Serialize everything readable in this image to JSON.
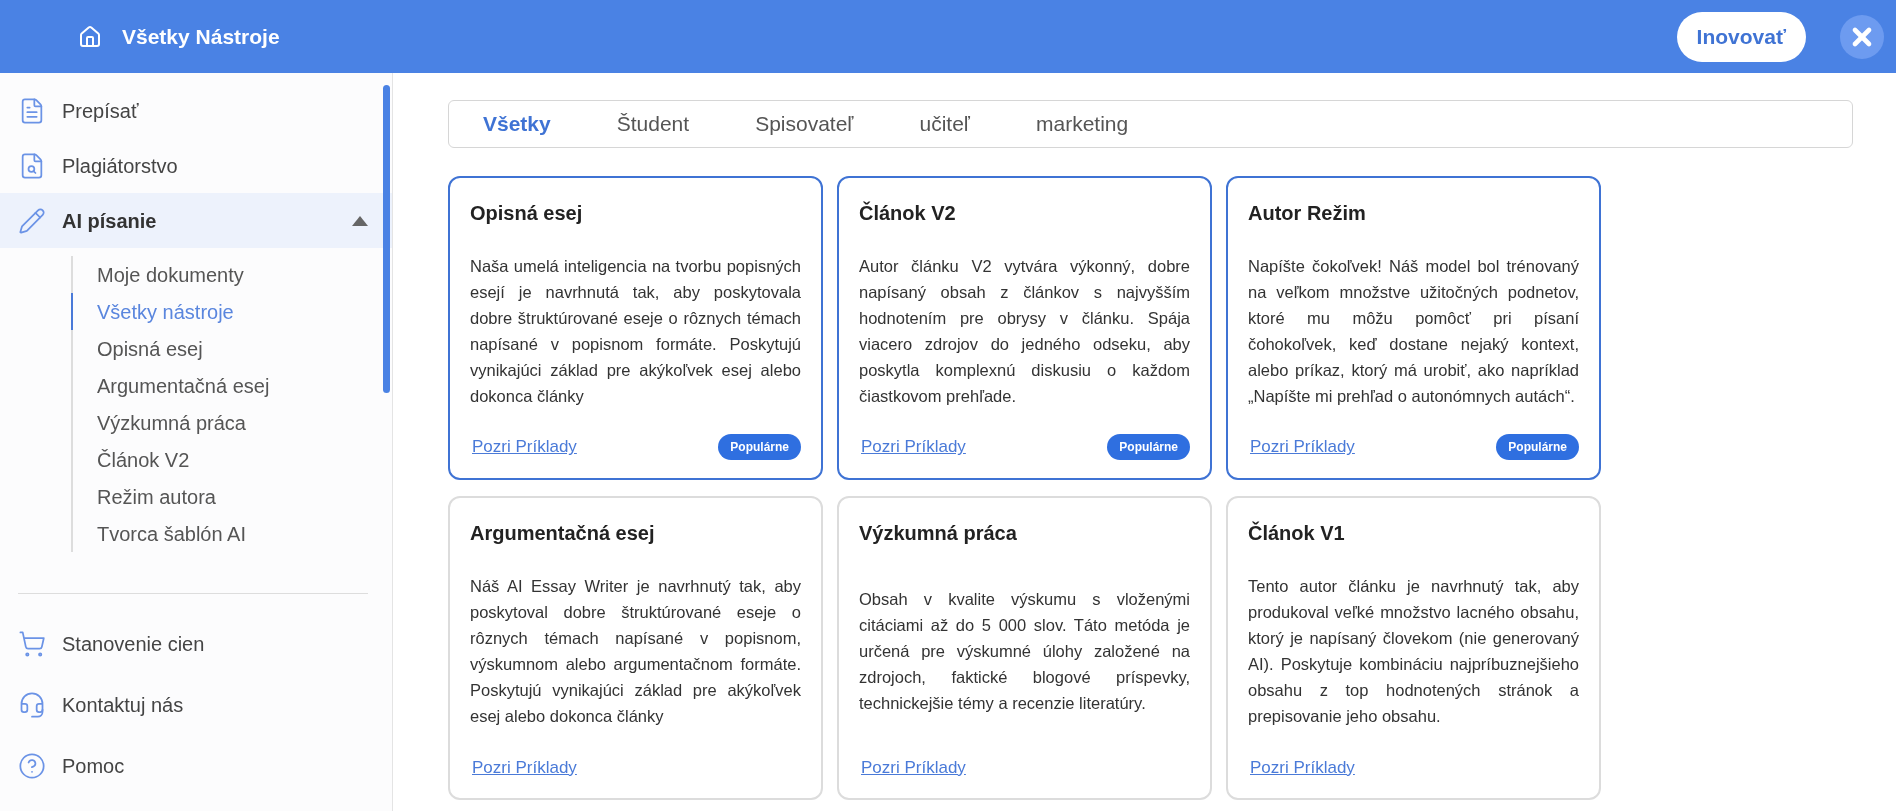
{
  "header": {
    "title": "Všetky Nástroje",
    "upgrade_button": "Inovovať"
  },
  "sidebar": {
    "items": [
      {
        "label": "Prepísať",
        "selected": false
      },
      {
        "label": "Plagiátorstvo",
        "selected": false
      },
      {
        "label": "AI písanie",
        "selected": true,
        "expanded": true,
        "children": [
          {
            "label": "Moje dokumenty",
            "selected": false
          },
          {
            "label": "Všetky nástroje",
            "selected": true
          },
          {
            "label": "Opisná esej",
            "selected": false
          },
          {
            "label": "Argumentačná esej",
            "selected": false
          },
          {
            "label": "Výzkumná práca",
            "selected": false
          },
          {
            "label": "Článok V2",
            "selected": false
          },
          {
            "label": "Režim autora",
            "selected": false
          },
          {
            "label": "Tvorca šablón AI",
            "selected": false
          }
        ]
      }
    ],
    "bottom_items": [
      {
        "label": "Stanovenie cien"
      },
      {
        "label": "Kontaktuj nás"
      },
      {
        "label": "Pomoc"
      }
    ]
  },
  "tabs": [
    {
      "label": "Všetky",
      "selected": true
    },
    {
      "label": "Študent",
      "selected": false
    },
    {
      "label": "Spisovateľ",
      "selected": false
    },
    {
      "label": "učiteľ",
      "selected": false
    },
    {
      "label": "marketing",
      "selected": false
    }
  ],
  "cards": [
    {
      "title": "Opisná esej",
      "description": "Naša umelá inteligencia na tvorbu popisných esejí je navrhnutá tak, aby poskytovala dobre štruktúrované eseje o rôznych témach napísané v popisnom formáte. Poskytujú vynikajúci základ pre akýkoľvek esej alebo dokonca články",
      "link": "Pozri Príklady",
      "badge": "Populárne"
    },
    {
      "title": "Článok V2",
      "description": "Autor článku V2 vytvára výkonný, dobre napísaný obsah z článkov s najvyšším hodnotením pre obrysy v článku. Spája viacero zdrojov do jedného odseku, aby poskytla komplexnú diskusiu o každom čiastkovom prehľade.",
      "link": "Pozri Príklady",
      "badge": "Populárne"
    },
    {
      "title": "Autor Režim",
      "description": "Napíšte čokoľvek! Náš model bol trénovaný na veľkom množstve užitočných podnetov, ktoré mu môžu pomôcť pri písaní čohokoľvek, keď dostane nejaký kontext, alebo príkaz, ktorý má urobiť, ako napríklad „Napíšte mi prehľad o autonómnych autách“.",
      "link": "Pozri Príklady",
      "badge": "Populárne"
    },
    {
      "title": "Argumentačná esej",
      "description": "Náš AI Essay Writer je navrhnutý tak, aby poskytoval dobre štruktúrované eseje o rôznych témach napísané v popisnom, výskumnom alebo argumentačnom formáte. Poskytujú vynikajúci základ pre akýkoľvek esej alebo dokonca články",
      "link": "Pozri Príklady"
    },
    {
      "title": "Výzkumná práca",
      "description": "Obsah v kvalite výskumu s vloženými citáciami až do 5 000 slov. Táto metóda je určená pre výskumné úlohy založené na zdrojoch, faktické blogové príspevky, technickejšie témy a recenzie literatúry.",
      "link": "Pozri Príklady"
    },
    {
      "title": "Článok V1",
      "description": "Tento autor článku je navrhnutý tak, aby produkoval veľké množstvo lacného obsahu, ktorý je napísaný človekom (nie generovaný AI). Poskytuje kombináciu najpríbuznejšieho obsahu z top hodnotených stránok a prepisovanie jeho obsahu.",
      "link": "Pozri Príklady"
    }
  ]
}
